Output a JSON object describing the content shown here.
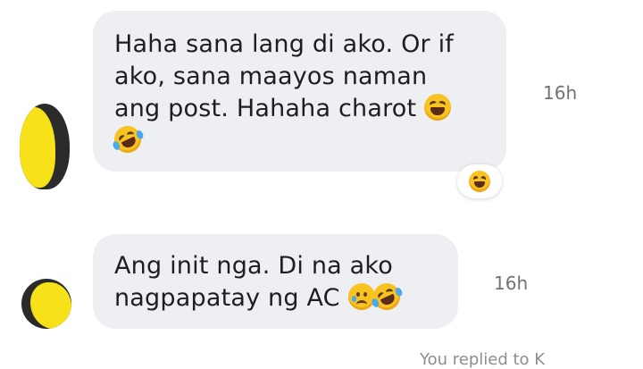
{
  "messages": [
    {
      "lines": [
        "Haha sana lang di ako. Or if",
        "ako, sana maayos naman",
        "ang post. Hahaha charot"
      ],
      "timestamp": "16h",
      "trailing_emoji": "grinning-squinting-face",
      "extra_emoji": "rolling-on-floor-laughing",
      "reaction": "grinning-squinting-face"
    },
    {
      "lines": [
        "Ang init nga. Di na ako",
        "nagpapatay ng AC"
      ],
      "timestamp": "16h",
      "trailing_emojis": [
        "face-holding-back-tears",
        "rolling-on-floor-laughing"
      ]
    }
  ],
  "footer_text": "You replied to K"
}
